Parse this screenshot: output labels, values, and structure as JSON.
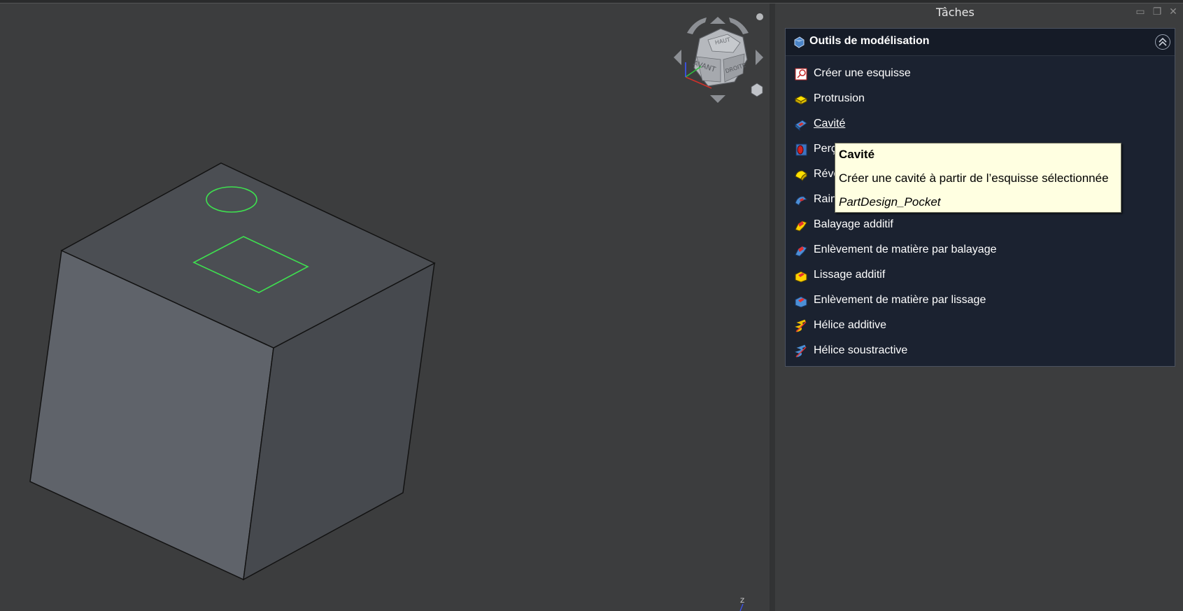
{
  "task_panel": {
    "title": "Tâches",
    "header_buttons": [
      "dock-toggle",
      "float",
      "close"
    ]
  },
  "tool_box": {
    "title": "Outils de modélisation",
    "items": [
      {
        "label": "Créer une esquisse",
        "icon": "sketch-icon"
      },
      {
        "label": "Protrusion",
        "icon": "pad-icon"
      },
      {
        "label": "Cavité",
        "icon": "pocket-icon"
      },
      {
        "label": "Perçage",
        "icon": "hole-icon"
      },
      {
        "label": "Révolution",
        "icon": "revolution-icon"
      },
      {
        "label": "Rainure",
        "icon": "groove-icon"
      },
      {
        "label": "Balayage additif",
        "icon": "additive-pipe-icon"
      },
      {
        "label": "Enlèvement de matière par balayage",
        "icon": "subtractive-pipe-icon"
      },
      {
        "label": "Lissage additif",
        "icon": "additive-loft-icon"
      },
      {
        "label": "Enlèvement de matière par lissage",
        "icon": "subtractive-loft-icon"
      },
      {
        "label": "Hélice additive",
        "icon": "additive-helix-icon"
      },
      {
        "label": "Hélice soustractive",
        "icon": "subtractive-helix-icon"
      }
    ],
    "hovered_item": "Cavité"
  },
  "tooltip": {
    "title": "Cavité",
    "description": "Créer une cavité à partir de l’esquisse sélectionnée",
    "command": "PartDesign_Pocket"
  },
  "navigation_cube": {
    "faces": [
      "HAUT",
      "AVANT",
      "DROITE"
    ]
  },
  "axis_indicator": {
    "label": "Z"
  },
  "colors": {
    "viewport_bg": "#3c3d3e",
    "panel_bg": "#1b2230",
    "sketch_green": "#3ee04f",
    "tooltip_bg": "#ffffe1"
  }
}
